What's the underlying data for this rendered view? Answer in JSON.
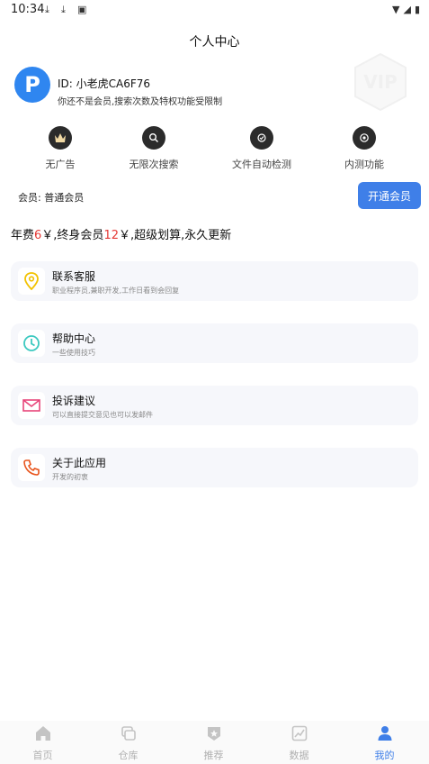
{
  "status_bar": {
    "time": "10:34"
  },
  "page_title": "个人中心",
  "profile": {
    "avatar_letter": "P",
    "id_text": "ID:  小老虎CA6F76",
    "notice": "你还不是会员,搜索次数及特权功能受限制",
    "vip_badge": "VIP"
  },
  "features": [
    {
      "label": "无广告",
      "icon": "crown-icon"
    },
    {
      "label": "无限次搜索",
      "icon": "search-icon"
    },
    {
      "label": "文件自动检测",
      "icon": "detect-icon"
    },
    {
      "label": "内测功能",
      "icon": "beta-icon"
    }
  ],
  "membership": {
    "label": "会员:  普通会员",
    "button": "开通会员"
  },
  "promo": {
    "p1": "年费",
    "n1": "6",
    "p2": "￥,终身会员",
    "n2": "12",
    "p3": "￥,超级划算,永久更新"
  },
  "menu": [
    {
      "title": "联系客服",
      "subtitle": "职业程序员,兼职开发,工作日看到会回复",
      "icon": "location-icon"
    },
    {
      "title": "帮助中心",
      "subtitle": "一些使用技巧",
      "icon": "clock-icon"
    },
    {
      "title": "投诉建议",
      "subtitle": "可以直接提交意见也可以发邮件",
      "icon": "mail-icon"
    },
    {
      "title": "关于此应用",
      "subtitle": "开发的初衷",
      "icon": "phone-icon"
    }
  ],
  "tabs": [
    {
      "label": "首页",
      "icon": "home-icon"
    },
    {
      "label": "仓库",
      "icon": "warehouse-icon"
    },
    {
      "label": "推荐",
      "icon": "recommend-icon"
    },
    {
      "label": "数据",
      "icon": "chart-icon"
    },
    {
      "label": "我的",
      "icon": "user-icon",
      "active": true
    }
  ],
  "colors": {
    "accent": "#3f7fe8",
    "price_red": "#e53935",
    "avatar_blue": "#2f86f0"
  }
}
